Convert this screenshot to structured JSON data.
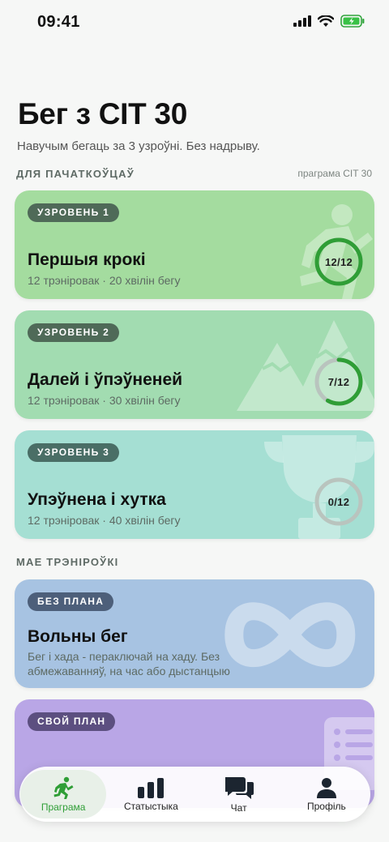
{
  "status_bar": {
    "time": "09:41"
  },
  "header": {
    "title": "Бег з CIT 30",
    "subtitle": "Навучым бегаць за 3 узроўні. Без надрыву."
  },
  "sections": {
    "beginners": {
      "label": "ДЛЯ ПАЧАТКОЎЦАЎ",
      "aside": "праграма CIT 30"
    },
    "my_workouts": {
      "label": "МАЕ ТРЭНІРОЎКІ"
    }
  },
  "levels": [
    {
      "badge": "УЗРОВЕНЬ 1",
      "title": "Першыя крокі",
      "subtitle": "12 трэніровак · 20 хвілін бегу",
      "progress_label": "12/12",
      "progress": 1.0,
      "color": "#a4dc9f",
      "icon": "running-person-icon"
    },
    {
      "badge": "УЗРОВЕНЬ 2",
      "title": "Далей і ўпэўненей",
      "subtitle": "12 трэніровак · 30 хвілін бегу",
      "progress_label": "7/12",
      "progress": 0.583,
      "color": "#a2dcb1",
      "icon": "mountains-icon"
    },
    {
      "badge": "УЗРОВЕНЬ 3",
      "title": "Упэўнена і хутка",
      "subtitle": "12 трэніровак · 40 хвілін бегу",
      "progress_label": "0/12",
      "progress": 0.0,
      "color": "#a5dfd3",
      "icon": "trophy-icon"
    }
  ],
  "workouts": [
    {
      "badge": "БЕЗ ПЛАНА",
      "title": "Вольны бег",
      "description": "Бег і хада - пераключай на хаду. Без абмежаванняў, на час або дыстанцыю",
      "color": "#a7c3e2",
      "icon": "infinity-icon"
    },
    {
      "badge": "СВОЙ ПЛАН",
      "color": "#b9a6e6",
      "icon": "list-icon"
    }
  ],
  "tabs": [
    {
      "label": "Праграма",
      "icon": "runner-icon",
      "active": true
    },
    {
      "label": "Статыстыка",
      "icon": "bar-chart-icon",
      "active": false
    },
    {
      "label": "Чат",
      "icon": "chat-icon",
      "active": false
    },
    {
      "label": "Профіль",
      "icon": "profile-icon",
      "active": false
    }
  ],
  "colors": {
    "accent": "#2f9e36",
    "ring_track": "#b9c4be",
    "badge": "#4f6a58"
  }
}
